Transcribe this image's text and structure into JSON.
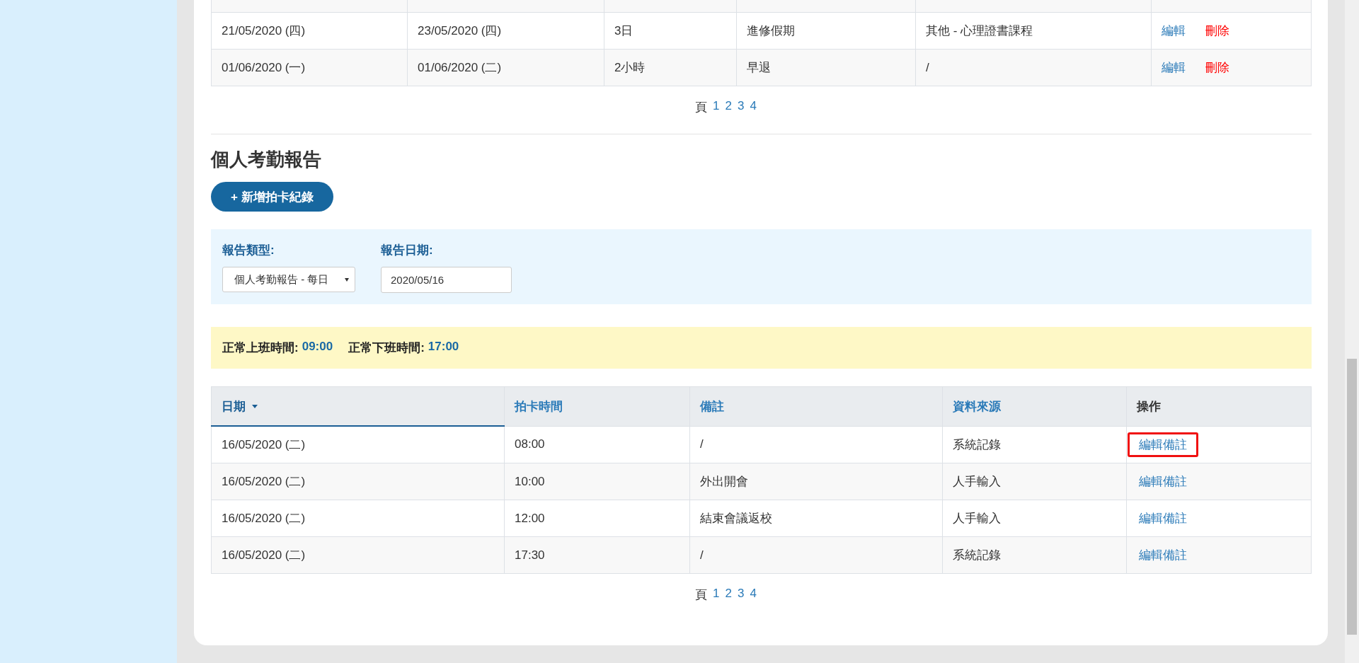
{
  "leave_table": {
    "rows": [
      {
        "cells": [
          "21/05/2020 (四)",
          "23/05/2020 (四)",
          "3日",
          "進修假期",
          "其他 - 心理證書課程"
        ],
        "actions": [
          {
            "label": "編輯",
            "kind": "edit"
          },
          {
            "label": "刪除",
            "kind": "delete"
          }
        ]
      },
      {
        "cells": [
          "01/06/2020 (一)",
          "01/06/2020 (二)",
          "2小時",
          "早退",
          "/"
        ],
        "actions": [
          {
            "label": "編輯",
            "kind": "edit"
          },
          {
            "label": "刪除",
            "kind": "delete"
          }
        ]
      }
    ],
    "pagination": {
      "label": "頁",
      "pages": [
        "1",
        "2",
        "3",
        "4"
      ]
    }
  },
  "attendance": {
    "title": "個人考勤報告",
    "add_button": "+ 新增拍卡紀錄",
    "filters": {
      "report_type": {
        "label": "報告類型:",
        "value": "個人考勤報告 - 每日"
      },
      "report_date": {
        "label": "報告日期:",
        "value": "2020/05/16"
      }
    },
    "notice": [
      {
        "label": "正常上班時間:",
        "value": "09:00"
      },
      {
        "label": "正常下班時間:",
        "value": "17:00"
      }
    ],
    "table": {
      "columns": [
        {
          "label": "日期",
          "sortable": true,
          "sorted": true
        },
        {
          "label": "拍卡時間",
          "sortable": true,
          "sorted": false
        },
        {
          "label": "備註",
          "sortable": true,
          "sorted": false
        },
        {
          "label": "資料來源",
          "sortable": true,
          "sorted": false
        },
        {
          "label": "操作",
          "sortable": false,
          "sorted": false
        }
      ],
      "rows": [
        {
          "cells": [
            "16/05/2020 (二)",
            "08:00",
            "/",
            "系統記錄"
          ],
          "action": "編輯備註",
          "highlighted": true
        },
        {
          "cells": [
            "16/05/2020 (二)",
            "10:00",
            "外出開會",
            "人手輸入"
          ],
          "action": "編輯備註",
          "highlighted": false
        },
        {
          "cells": [
            "16/05/2020 (二)",
            "12:00",
            "結束會議返校",
            "人手輸入"
          ],
          "action": "編輯備註",
          "highlighted": false
        },
        {
          "cells": [
            "16/05/2020 (二)",
            "17:30",
            "/",
            "系統記錄"
          ],
          "action": "編輯備註",
          "highlighted": false
        }
      ]
    },
    "pagination": {
      "label": "頁",
      "pages": [
        "1",
        "2",
        "3",
        "4"
      ]
    }
  }
}
